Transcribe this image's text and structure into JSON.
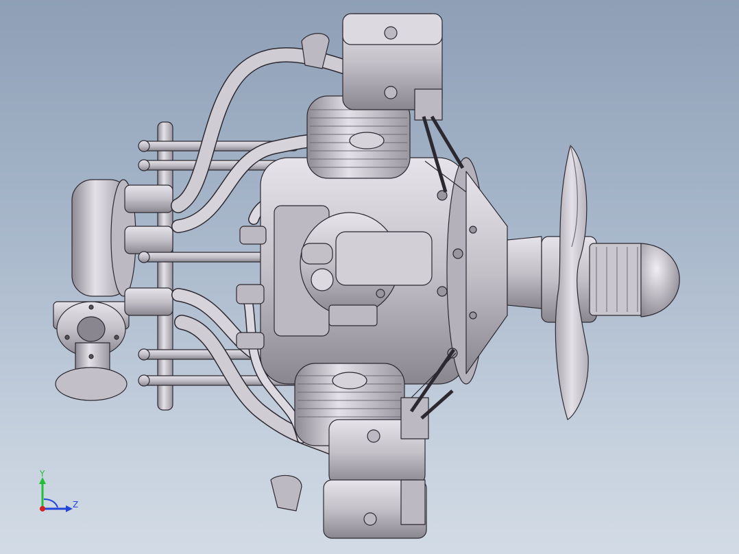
{
  "viewport": {
    "background_top": "#8e9fb6",
    "background_bottom": "#d2dbe5"
  },
  "model": {
    "part_color": "#c9c6cd",
    "shadow_color": "#7d7983",
    "edge_color": "#2b2830",
    "components": [
      "intake-flange",
      "exhaust-manifold",
      "crankcase",
      "cylinder-top",
      "cylinder-bottom",
      "cylinder-center",
      "propeller",
      "spinner"
    ]
  },
  "triad": {
    "y_label": "Y",
    "z_label": "Z",
    "y_color": "#1fbf3a",
    "z_color": "#2346d8",
    "x_color": "#d42020"
  }
}
